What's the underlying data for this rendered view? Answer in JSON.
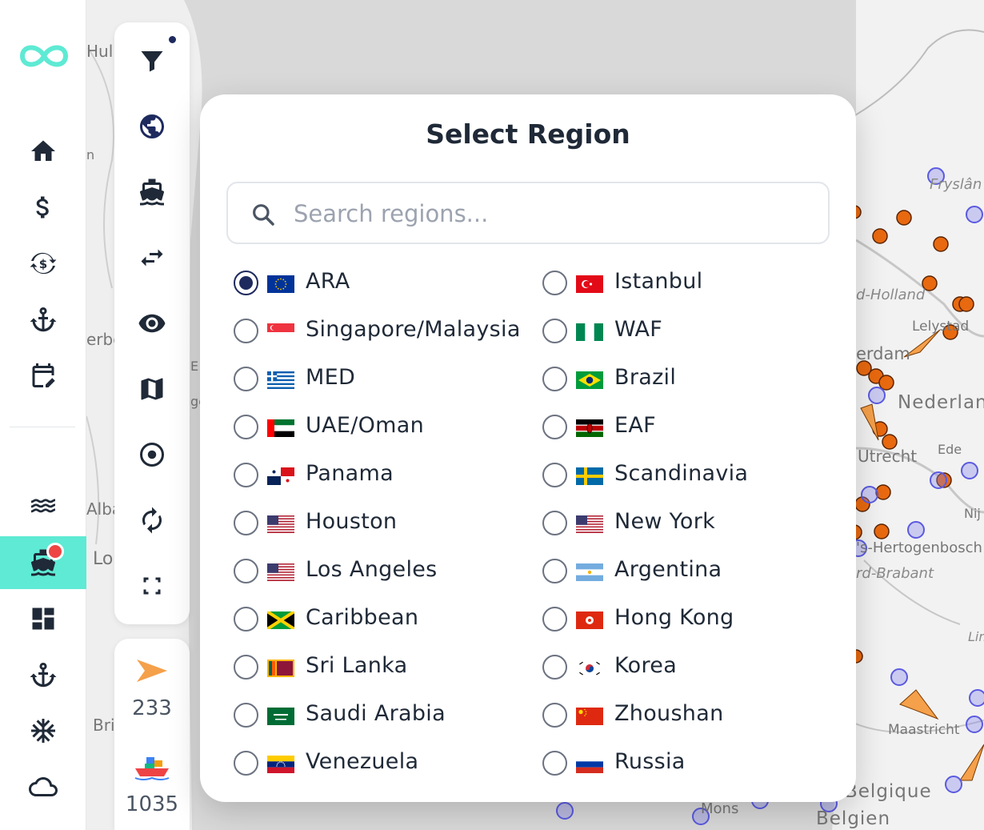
{
  "nav": {
    "items": [
      {
        "name": "home-icon"
      },
      {
        "name": "dollar-icon"
      },
      {
        "name": "currency-exchange-icon"
      },
      {
        "name": "anchor-icon"
      },
      {
        "name": "calendar-edit-icon"
      },
      {
        "name": "waves-icon"
      },
      {
        "name": "ship-icon",
        "active": true,
        "badge": true
      },
      {
        "name": "dashboard-icon"
      },
      {
        "name": "anchor-icon"
      },
      {
        "name": "snowflake-icon"
      },
      {
        "name": "cloud-icon"
      }
    ],
    "accent_color": "#5eead4"
  },
  "tools": {
    "items": [
      "filter-icon",
      "globe-icon",
      "ship-icon",
      "swap-arrows-icon",
      "eye-icon",
      "map-icon",
      "target-icon",
      "refresh-icon",
      "fullscreen-icon"
    ],
    "filter_active": true
  },
  "counts": {
    "vessels_moving": "233",
    "vessels_total": "1035"
  },
  "map": {
    "labels": [
      "Hull",
      "Alba",
      "Lo",
      "erbo",
      "Bri",
      "E",
      "ge",
      "n",
      "Fryslân",
      "d-Holland",
      "Lelystad",
      "erdam",
      "Nederlan",
      "Utrecht",
      "Ede",
      "Nij",
      "'s-Hertogenbosch",
      "rd-Brabant",
      "Lim",
      "Maastricht",
      "Mons",
      "Belgique",
      "Belgien"
    ]
  },
  "modal": {
    "title": "Select Region",
    "search_placeholder": "Search regions...",
    "selected": "ARA",
    "regions_left": [
      {
        "label": "ARA",
        "flag": "eu"
      },
      {
        "label": "Singapore/Malaysia",
        "flag": "sg"
      },
      {
        "label": "MED",
        "flag": "gr"
      },
      {
        "label": "UAE/Oman",
        "flag": "ae"
      },
      {
        "label": "Panama",
        "flag": "pa"
      },
      {
        "label": "Houston",
        "flag": "us"
      },
      {
        "label": "Los Angeles",
        "flag": "us"
      },
      {
        "label": "Caribbean",
        "flag": "jm"
      },
      {
        "label": "Sri Lanka",
        "flag": "lk"
      },
      {
        "label": "Saudi Arabia",
        "flag": "sa"
      },
      {
        "label": "Venezuela",
        "flag": "ve"
      }
    ],
    "regions_right": [
      {
        "label": "Istanbul",
        "flag": "tr"
      },
      {
        "label": "WAF",
        "flag": "ng"
      },
      {
        "label": "Brazil",
        "flag": "br"
      },
      {
        "label": "EAF",
        "flag": "ke"
      },
      {
        "label": "Scandinavia",
        "flag": "se"
      },
      {
        "label": "New York",
        "flag": "us"
      },
      {
        "label": "Argentina",
        "flag": "ar"
      },
      {
        "label": "Hong Kong",
        "flag": "hk"
      },
      {
        "label": "Korea",
        "flag": "kr"
      },
      {
        "label": "Zhoushan",
        "flag": "cn"
      },
      {
        "label": "Russia",
        "flag": "ru"
      }
    ]
  }
}
